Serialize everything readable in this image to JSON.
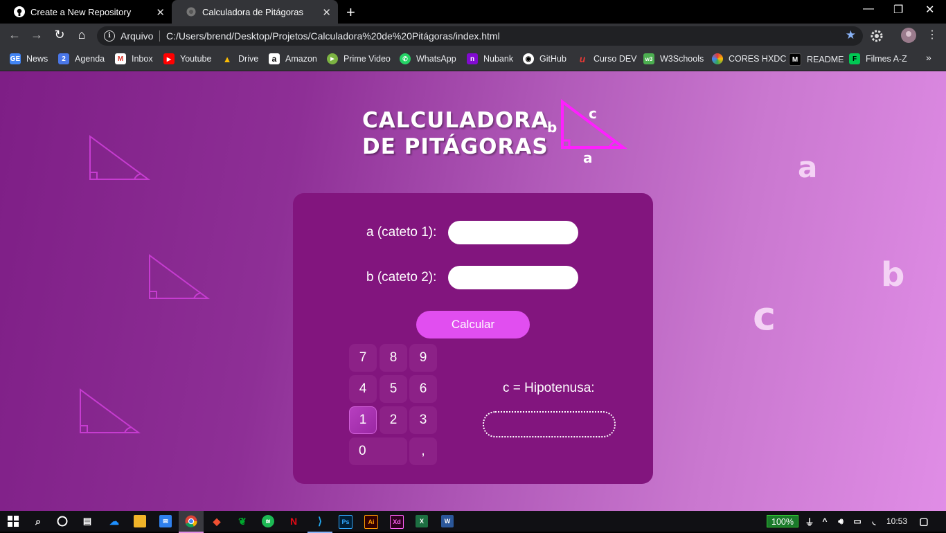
{
  "browser": {
    "tabs": [
      {
        "title": "Create a New Repository",
        "icon": "github-icon"
      },
      {
        "title": "Calculadora de Pitágoras",
        "icon": "globe-icon",
        "active": true
      }
    ],
    "address_prefix": "Arquivo",
    "url": "C:/Users/brend/Desktop/Projetos/Calculadora%20de%20Pitágoras/index.html",
    "bookmarks": [
      {
        "label": "News",
        "icon": "google-news-icon",
        "color": "#4285f4",
        "glyph": "GE"
      },
      {
        "label": "Agenda",
        "icon": "calendar-icon",
        "color": "#4a77e8",
        "glyph": "2"
      },
      {
        "label": "Inbox",
        "icon": "gmail-icon",
        "color": "#ffffff",
        "glyph": "M"
      },
      {
        "label": "Youtube",
        "icon": "youtube-icon",
        "color": "#ff0000",
        "glyph": "▶"
      },
      {
        "label": "Drive",
        "icon": "drive-icon",
        "color": "#fbbc04",
        "glyph": "▲"
      },
      {
        "label": "Amazon",
        "icon": "amazon-icon",
        "color": "#ffffff",
        "glyph": "a"
      },
      {
        "label": "Prime Video",
        "icon": "prime-video-icon",
        "color": "#7cb342",
        "glyph": "▶"
      },
      {
        "label": "WhatsApp",
        "icon": "whatsapp-icon",
        "color": "#25d366",
        "glyph": "✆"
      },
      {
        "label": "Nubank",
        "icon": "nubank-icon",
        "color": "#820ad1",
        "glyph": "n"
      },
      {
        "label": "GitHub",
        "icon": "github-icon",
        "color": "#333438",
        "glyph": "◉"
      },
      {
        "label": "Curso DEV",
        "icon": "curso-dev-icon",
        "color": "#e53935",
        "glyph": "u"
      },
      {
        "label": "W3Schools",
        "icon": "w3schools-icon",
        "color": "#4caf50",
        "glyph": "w3"
      },
      {
        "label": "CORES HXDC",
        "icon": "color-wheel-icon",
        "color": "#ffffff",
        "glyph": "●"
      },
      {
        "label": "README",
        "icon": "medium-icon",
        "color": "#000000",
        "glyph": "M"
      },
      {
        "label": "Filmes A-Z",
        "icon": "filmes-icon",
        "color": "#00c853",
        "glyph": "F"
      }
    ]
  },
  "page": {
    "title_line1": "CALCULADORA",
    "title_line2": "DE PITÁGORAS",
    "logo_labels": {
      "a": "a",
      "b": "b",
      "c": "c"
    },
    "floating_letters": {
      "a": "a",
      "b": "b",
      "c": "c"
    },
    "form": {
      "label_a": "a (cateto 1):",
      "label_b": "b (cateto 2):",
      "value_a": "",
      "value_b": "",
      "calc_button": "Calcular",
      "result_label": "c = Hipotenusa:",
      "result_value": ""
    },
    "keypad": [
      "7",
      "8",
      "9",
      "4",
      "5",
      "6",
      "1",
      "2",
      "3",
      "0",
      ","
    ],
    "accent_color": "#e14ef0",
    "card_color": "#82157e"
  },
  "taskbar": {
    "battery": "100%",
    "time": "10:53"
  }
}
